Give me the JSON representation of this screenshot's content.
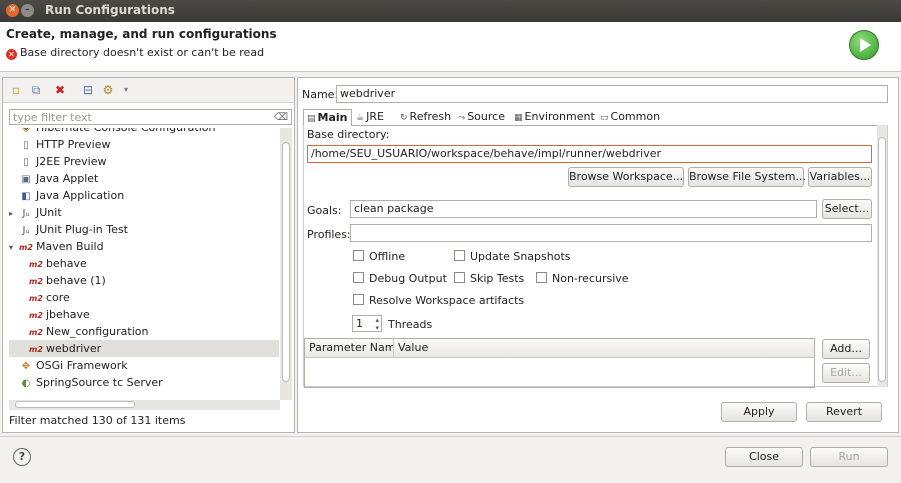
{
  "window": {
    "title": "Run Configurations"
  },
  "header": {
    "heading": "Create, manage, and run configurations",
    "error": "Base directory doesn't exist or can't be read"
  },
  "left": {
    "filter_placeholder": "type filter text",
    "tree": [
      {
        "label": "Hibernate Console Configuration",
        "icon": "hibernate-icon",
        "indent": 1,
        "partial": true
      },
      {
        "label": "HTTP Preview",
        "icon": "document-icon",
        "indent": 1
      },
      {
        "label": "J2EE Preview",
        "icon": "document-icon",
        "indent": 1
      },
      {
        "label": "Java Applet",
        "icon": "applet-icon",
        "indent": 1
      },
      {
        "label": "Java Application",
        "icon": "java-app-icon",
        "indent": 1
      },
      {
        "label": "JUnit",
        "icon": "junit-icon",
        "indent": 0,
        "expander": "▸"
      },
      {
        "label": "JUnit Plug-in Test",
        "icon": "junit-plugin-icon",
        "indent": 1
      },
      {
        "label": "Maven Build",
        "icon": "maven-icon",
        "indent": 0,
        "expander": "▾"
      },
      {
        "label": "behave",
        "icon": "maven-icon",
        "indent": 2
      },
      {
        "label": "behave (1)",
        "icon": "maven-icon",
        "indent": 2
      },
      {
        "label": "core",
        "icon": "maven-icon",
        "indent": 2
      },
      {
        "label": "jbehave",
        "icon": "maven-icon",
        "indent": 2
      },
      {
        "label": "New_configuration",
        "icon": "maven-icon",
        "indent": 2
      },
      {
        "label": "webdriver",
        "icon": "maven-icon",
        "indent": 2,
        "selected": true
      },
      {
        "label": "OSGi Framework",
        "icon": "osgi-icon",
        "indent": 1
      },
      {
        "label": "SpringSource tc Server",
        "icon": "spring-icon",
        "indent": 1
      }
    ],
    "status": "Filter matched 130 of 131 items"
  },
  "right": {
    "name_label": "Name:",
    "name_value": "webdriver",
    "tabs": [
      {
        "label": "Main",
        "icon": "main-tab-icon",
        "active": true
      },
      {
        "label": "JRE",
        "icon": "jre-icon"
      },
      {
        "label": "Refresh",
        "icon": "refresh-icon"
      },
      {
        "label": "Source",
        "icon": "source-icon"
      },
      {
        "label": "Environment",
        "icon": "environment-icon"
      },
      {
        "label": "Common",
        "icon": "common-icon"
      }
    ],
    "base_dir_label": "Base directory:",
    "base_dir_value": "/home/SEU_USUARIO/workspace/behave/impl/runner/webdriver",
    "browse_workspace": "Browse Workspace...",
    "browse_fs": "Browse File System...",
    "variables": "Variables...",
    "goals_label": "Goals:",
    "goals_value": "clean package",
    "select_label": "Select...",
    "profiles_label": "Profiles:",
    "profiles_value": "",
    "checks": {
      "offline": "Offline",
      "update_snapshots": "Update Snapshots",
      "debug_output": "Debug Output",
      "skip_tests": "Skip Tests",
      "non_recursive": "Non-recursive",
      "resolve_workspace": "Resolve Workspace artifacts"
    },
    "threads_value": "1",
    "threads_label": "Threads",
    "param_header_name": "Parameter Name",
    "param_header_value": "Value",
    "add_label": "Add...",
    "edit_label": "Edit...",
    "apply_label": "Apply",
    "revert_label": "Revert"
  },
  "footer": {
    "close_label": "Close",
    "run_label": "Run"
  }
}
